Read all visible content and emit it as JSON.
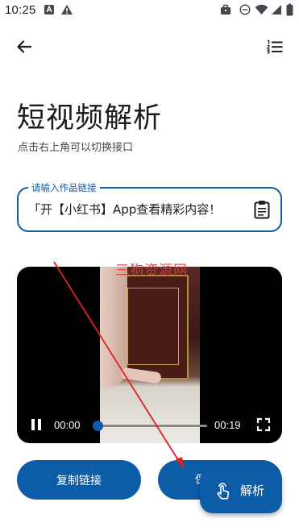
{
  "status_bar": {
    "time": "10:25"
  },
  "app_bar": {
    "back_icon": "arrow-back-icon",
    "menu_icon": "format-list-numbered-icon"
  },
  "page": {
    "title": "短视频解析",
    "subtitle": "点击右上角可以切换接口"
  },
  "link_input": {
    "label": "请输入作品链接",
    "value": "「开【小红书】App查看精彩内容！",
    "clipboard_icon": "clipboard-icon"
  },
  "video_player": {
    "current_time": "00:00",
    "total_time": "00:19",
    "progress_fraction": 0.0,
    "play_icon": "pause-icon",
    "fullscreen_icon": "fullscreen-icon"
  },
  "watermark": "三狗资源网",
  "actions": {
    "copy_link_label": "复制链接",
    "second_button_peek": "保"
  },
  "fab": {
    "label": "解析",
    "icon": "touch-icon"
  },
  "colors": {
    "primary": "#0d5ca8",
    "annotation": "#e02020"
  }
}
